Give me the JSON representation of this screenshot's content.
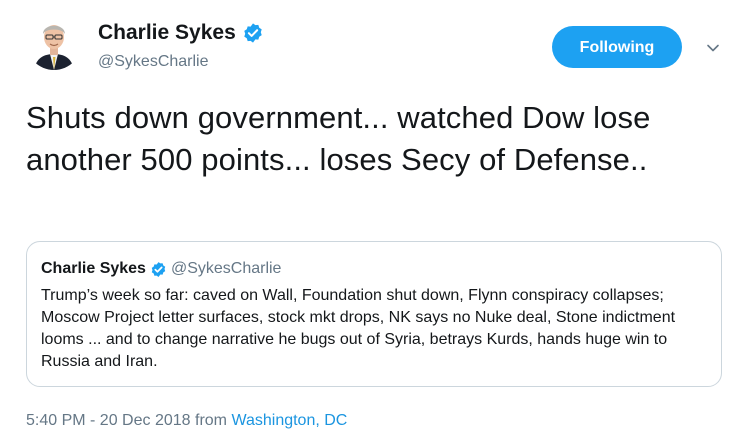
{
  "author": {
    "name": "Charlie Sykes",
    "handle": "@SykesCharlie",
    "verified": true
  },
  "follow_button": {
    "label": "Following",
    "color": "#1da1f2"
  },
  "tweet": {
    "text": "Shuts down government... watched Dow lose another 500 points... loses Secy of Defense.."
  },
  "quoted_tweet": {
    "name": "Charlie Sykes",
    "handle": "@SykesCharlie",
    "verified": true,
    "text": "Trump’s week so far: caved on Wall, Foundation shut down, Flynn conspiracy collapses; Moscow Project letter surfaces, stock mkt drops, NK says no Nuke deal, Stone indictment looms ... and to change narrative he bugs out of Syria, betrays Kurds, hands huge win to Russia and Iran."
  },
  "meta": {
    "timestamp": "5:40 PM - 20 Dec 2018",
    "from_label": "from",
    "location": "Washington, DC"
  },
  "icons": {
    "verified": "verified-badge-icon",
    "caret": "chevron-down-icon"
  },
  "colors": {
    "accent": "#1da1f2",
    "link": "#1b95e0",
    "secondary_text": "#657786",
    "border": "#ccd6dd"
  }
}
